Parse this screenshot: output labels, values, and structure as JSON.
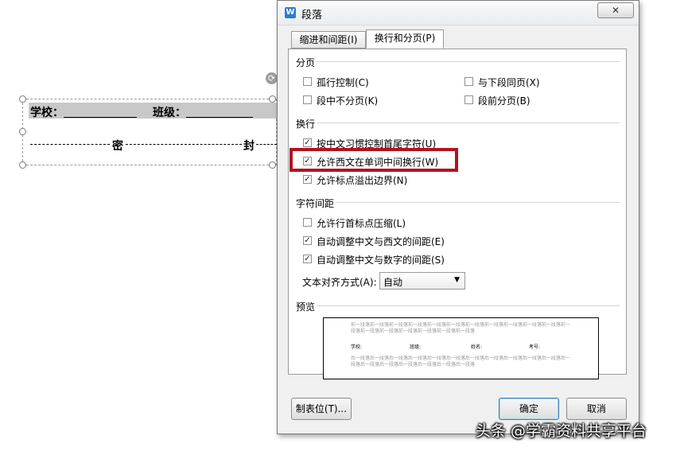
{
  "document": {
    "school_label": "学校：",
    "class_label": "班级：",
    "seal_char_1": "密",
    "seal_char_2": "封"
  },
  "dialog": {
    "title": "段落",
    "app_icon": "W",
    "close_glyph": "✕",
    "tabs": [
      {
        "label": "缩进和间距(I)",
        "active": false
      },
      {
        "label": "换行和分页(P)",
        "active": true
      }
    ],
    "sections": {
      "pagination": {
        "label": "分页",
        "options": [
          {
            "label": "孤行控制(C)",
            "checked": false
          },
          {
            "label": "与下段同页(X)",
            "checked": false
          },
          {
            "label": "段中不分页(K)",
            "checked": false
          },
          {
            "label": "段前分页(B)",
            "checked": false
          }
        ]
      },
      "line_break": {
        "label": "换行",
        "options": [
          {
            "label": "按中文习惯控制首尾字符(U)",
            "checked": true
          },
          {
            "label": "允许西文在单词中间换行(W)",
            "checked": true
          },
          {
            "label": "允许标点溢出边界(N)",
            "checked": true
          }
        ]
      },
      "char_spacing": {
        "label": "字符间距",
        "options": [
          {
            "label": "允许行首标点压缩(L)",
            "checked": false
          },
          {
            "label": "自动调整中文与西文的间距(E)",
            "checked": true
          },
          {
            "label": "自动调整中文与数字的间距(S)",
            "checked": true
          }
        ],
        "alignment_label": "文本对齐方式(A):",
        "alignment_value": "自动"
      },
      "preview": {
        "label": "预览",
        "prev_paragraph_text": "前一段落前一段落前一段落前一段落前一段落前一段落前一段落前一段落前一段落前一段落前一段落前一段落前一段落前一段落前一段落前一段落前一段落前一段落",
        "sample": [
          "学校:",
          "班级:",
          "姓名:",
          "考号:"
        ],
        "next_paragraph_text": "后一段落后一段落后一段落后一段落后一段落后一段落后一段落后一段落后一段落后一段落后一段落后一段落后一段落后一段落后一段落后一段落后一段落后一段落"
      }
    },
    "buttons": {
      "tabs_stops": "制表位(T)...",
      "ok": "确定",
      "cancel": "取消"
    },
    "colors": {
      "highlight": "#b3121f",
      "icon": "#2b7cd3"
    }
  },
  "watermark": "头条 @学霸资料共享平台"
}
